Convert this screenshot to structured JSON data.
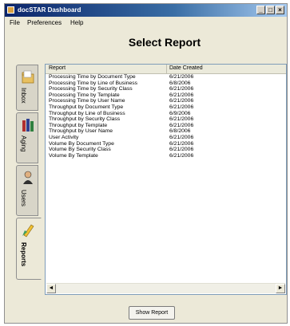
{
  "window": {
    "title": "docSTAR Dashboard"
  },
  "menu": {
    "file": "File",
    "preferences": "Preferences",
    "help": "Help"
  },
  "page": {
    "heading": "Select Report"
  },
  "tabs": [
    {
      "label": "Inbox",
      "icon": "folder-icon"
    },
    {
      "label": "Aging",
      "icon": "books-icon"
    },
    {
      "label": "Users",
      "icon": "user-icon"
    },
    {
      "label": "Reports",
      "icon": "pencil-icon"
    }
  ],
  "table": {
    "columns": [
      "Report",
      "Date Created"
    ],
    "rows": [
      [
        "Processing Time by Document Type",
        "6/21/2006"
      ],
      [
        "Processing Time by Line of Business",
        "6/8/2006"
      ],
      [
        "Processing Time by Security Class",
        "6/21/2006"
      ],
      [
        "Processing Time by Template",
        "6/21/2006"
      ],
      [
        "Processing Time by User Name",
        "6/21/2006"
      ],
      [
        "Throughput by Document Type",
        "6/21/2006"
      ],
      [
        "Throughput by Line of Business",
        "6/9/2006"
      ],
      [
        "Throughput by Security Class",
        "6/21/2006"
      ],
      [
        "Throughput by Template",
        "6/21/2006"
      ],
      [
        "Throughput by User Name",
        "6/8/2006"
      ],
      [
        "User Activity",
        "6/21/2006"
      ],
      [
        "Volume By Document Type",
        "6/21/2006"
      ],
      [
        "Volume By Security Class",
        "6/21/2006"
      ],
      [
        "Volume By Template",
        "6/21/2006"
      ]
    ]
  },
  "actions": {
    "show_report": "Show Report"
  }
}
